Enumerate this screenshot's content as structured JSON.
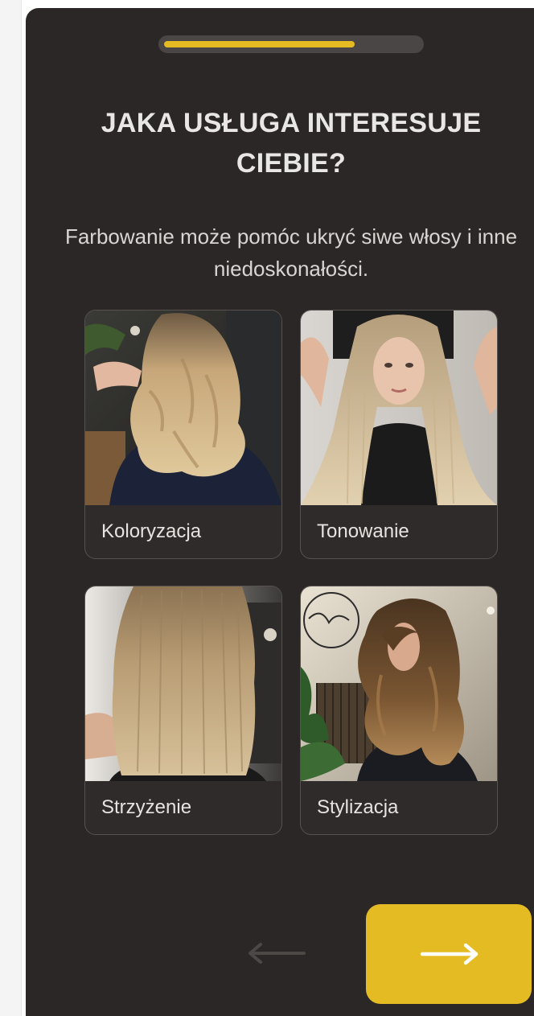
{
  "quiz": {
    "progress_fraction": 0.75,
    "accent_color": "#e5bb24",
    "question_title": "JAKA USŁUGA INTERESUJE CIEBIE?",
    "description": "Farbowanie może pomóc ukryć siwe włosy i inne niedoskonałości.",
    "options": [
      {
        "label": "Koloryzacja",
        "image": "salon-wavy-blonde-back-photo"
      },
      {
        "label": "Tonowanie",
        "image": "long-straight-blonde-model-photo"
      },
      {
        "label": "Strzyżenie",
        "image": "straight-bob-back-photo"
      },
      {
        "label": "Stylizacja",
        "image": "layered-brunette-curls-photo"
      }
    ],
    "navigation": {
      "back_icon": "arrow-left-icon",
      "next_icon": "arrow-right-icon"
    }
  }
}
